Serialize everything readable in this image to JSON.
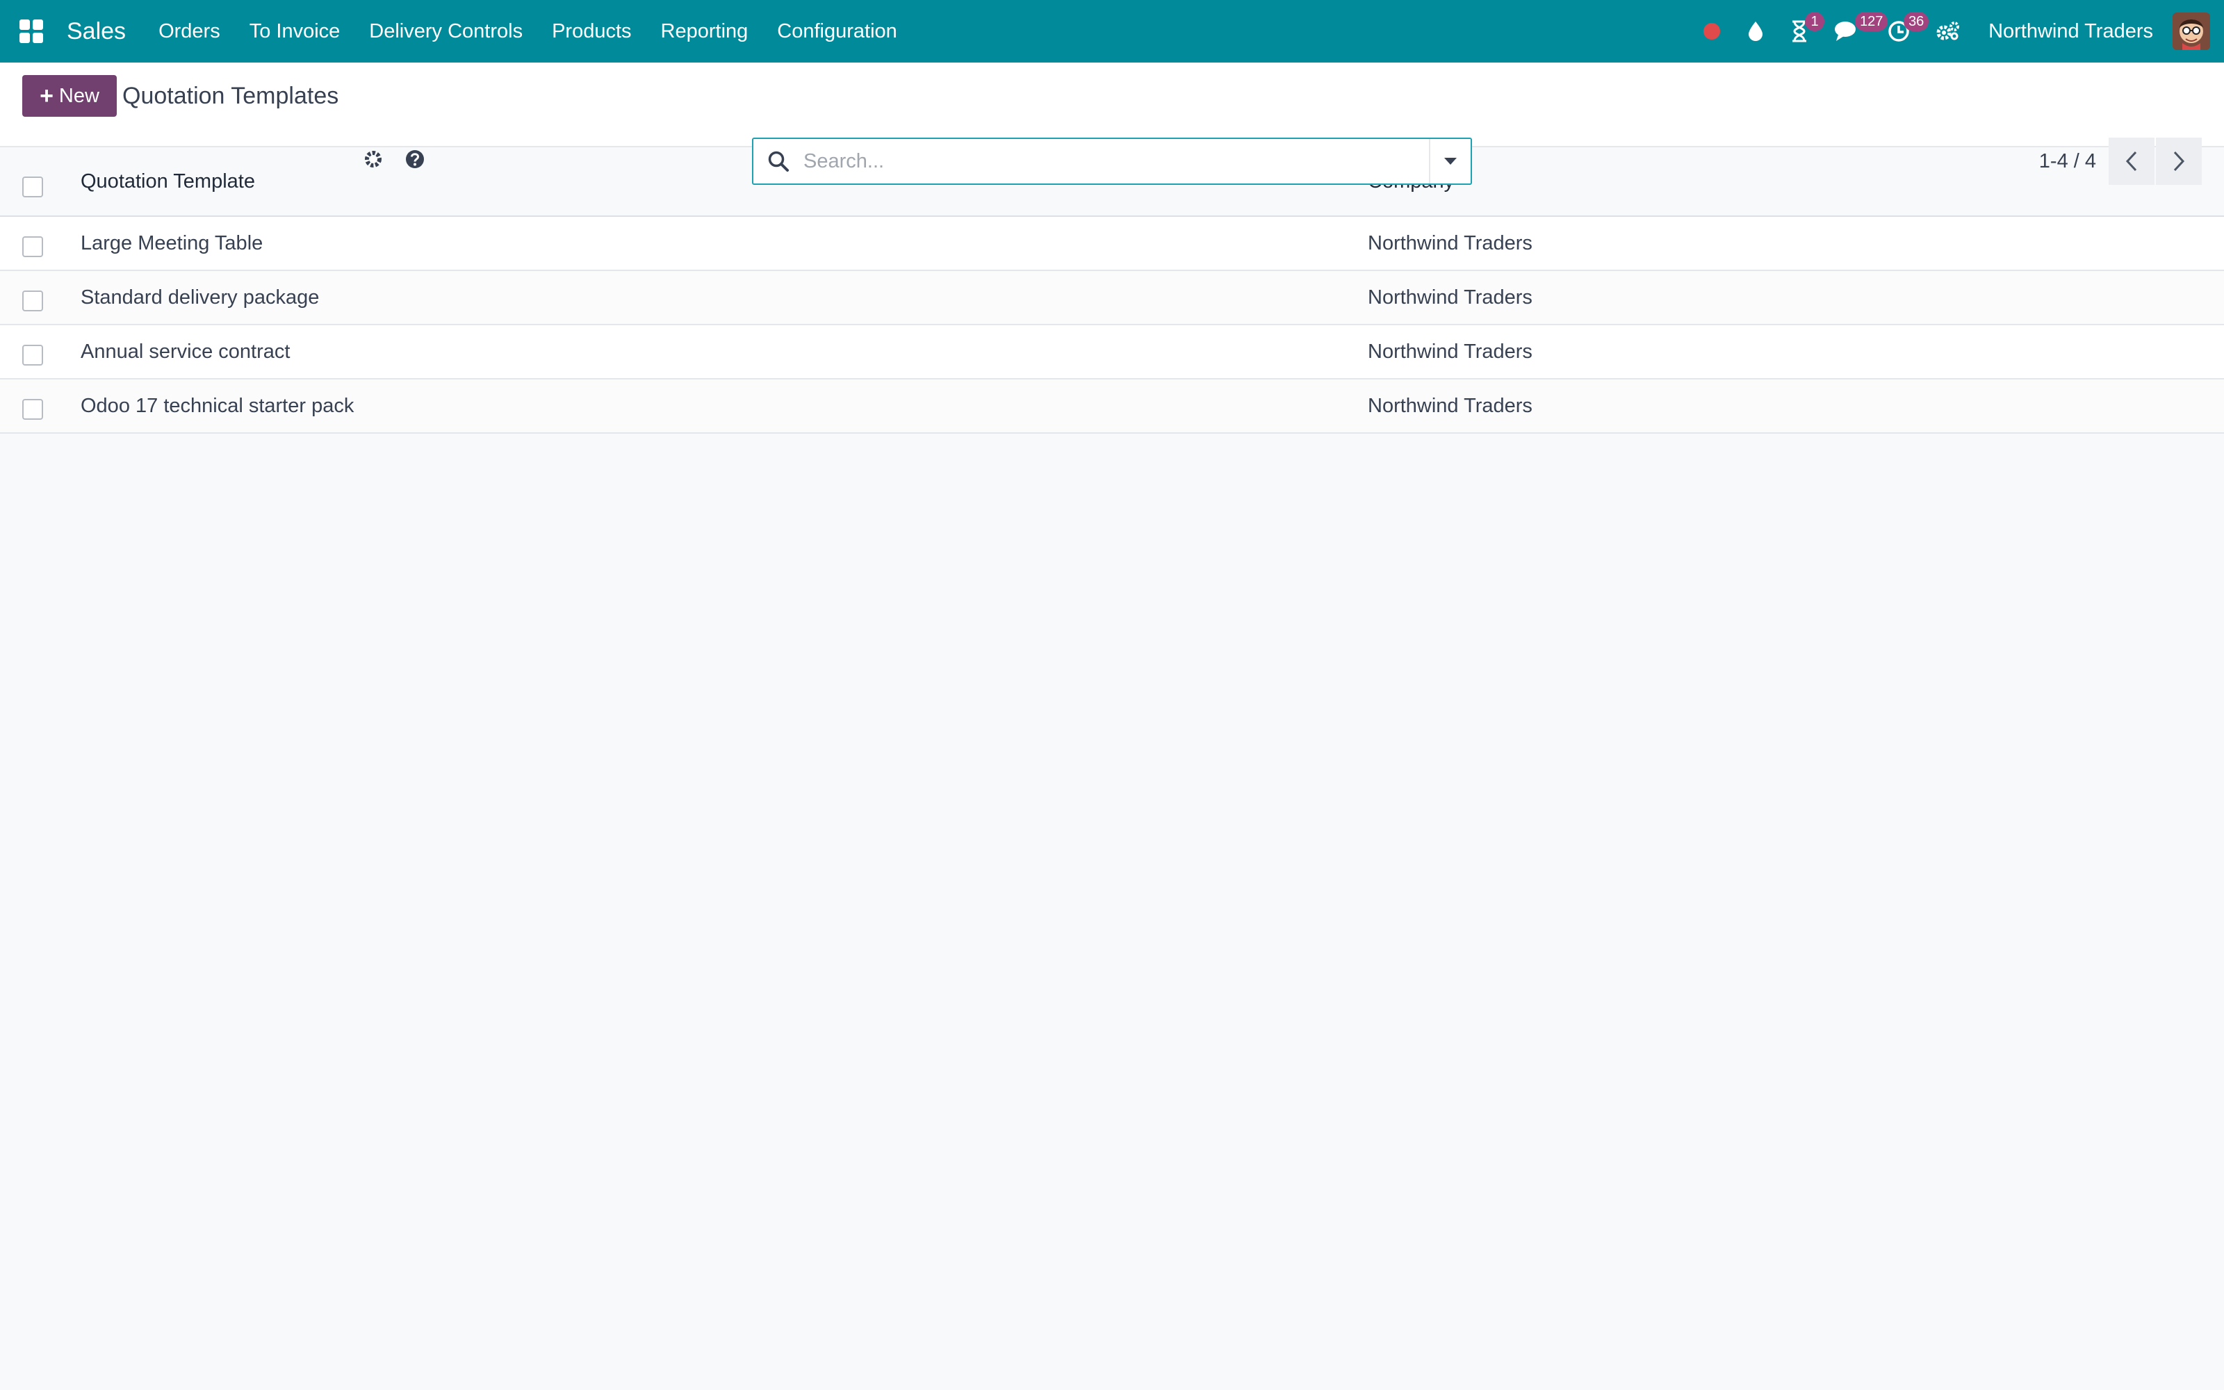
{
  "navbar": {
    "app_name": "Sales",
    "menu": [
      "Orders",
      "To Invoice",
      "Delivery Controls",
      "Products",
      "Reporting",
      "Configuration"
    ],
    "badges": {
      "activities": "1",
      "messages": "127",
      "clock": "36"
    },
    "company": "Northwind Traders",
    "record_dot_color": "#e04a4a"
  },
  "control_panel": {
    "new_label": "New",
    "title": "Quotation Templates",
    "search_placeholder": "Search...",
    "pager_value": "1-4 / 4"
  },
  "list": {
    "headers": {
      "name": "Quotation Template",
      "company": "Company"
    },
    "rows": [
      {
        "name": "Large Meeting Table",
        "company": "Northwind Traders"
      },
      {
        "name": "Standard delivery package",
        "company": "Northwind Traders"
      },
      {
        "name": "Annual service contract",
        "company": "Northwind Traders"
      },
      {
        "name": "Odoo 17 technical starter pack",
        "company": "Northwind Traders"
      }
    ]
  }
}
